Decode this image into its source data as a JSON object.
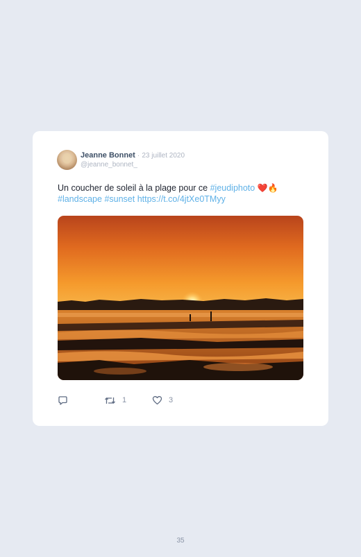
{
  "tweet": {
    "author_name": "Jeanne Bonnet",
    "separator": "·",
    "date": "23 juillet 2020",
    "handle": "@jeanne_bonnet_",
    "text_plain": "Un coucher de soleil à la plage pour ce ",
    "hashtag_1": "#jeudiphoto",
    "emoji": "❤️🔥",
    "hashtag_2": "#landscape",
    "hashtag_3": "#sunset",
    "link": "https://t.co/4jtXe0TMyy",
    "photo_icon": "sunset-beach-photo"
  },
  "actions": {
    "reply_icon": "reply-icon",
    "retweet_icon": "retweet-icon",
    "retweet_count": "1",
    "like_icon": "heart-icon",
    "like_count": "3"
  },
  "page_number": "35",
  "colors": {
    "background": "#e6eaf2",
    "link": "#5fb1e7",
    "name": "#3d4f66",
    "muted": "#aeb5c2"
  }
}
